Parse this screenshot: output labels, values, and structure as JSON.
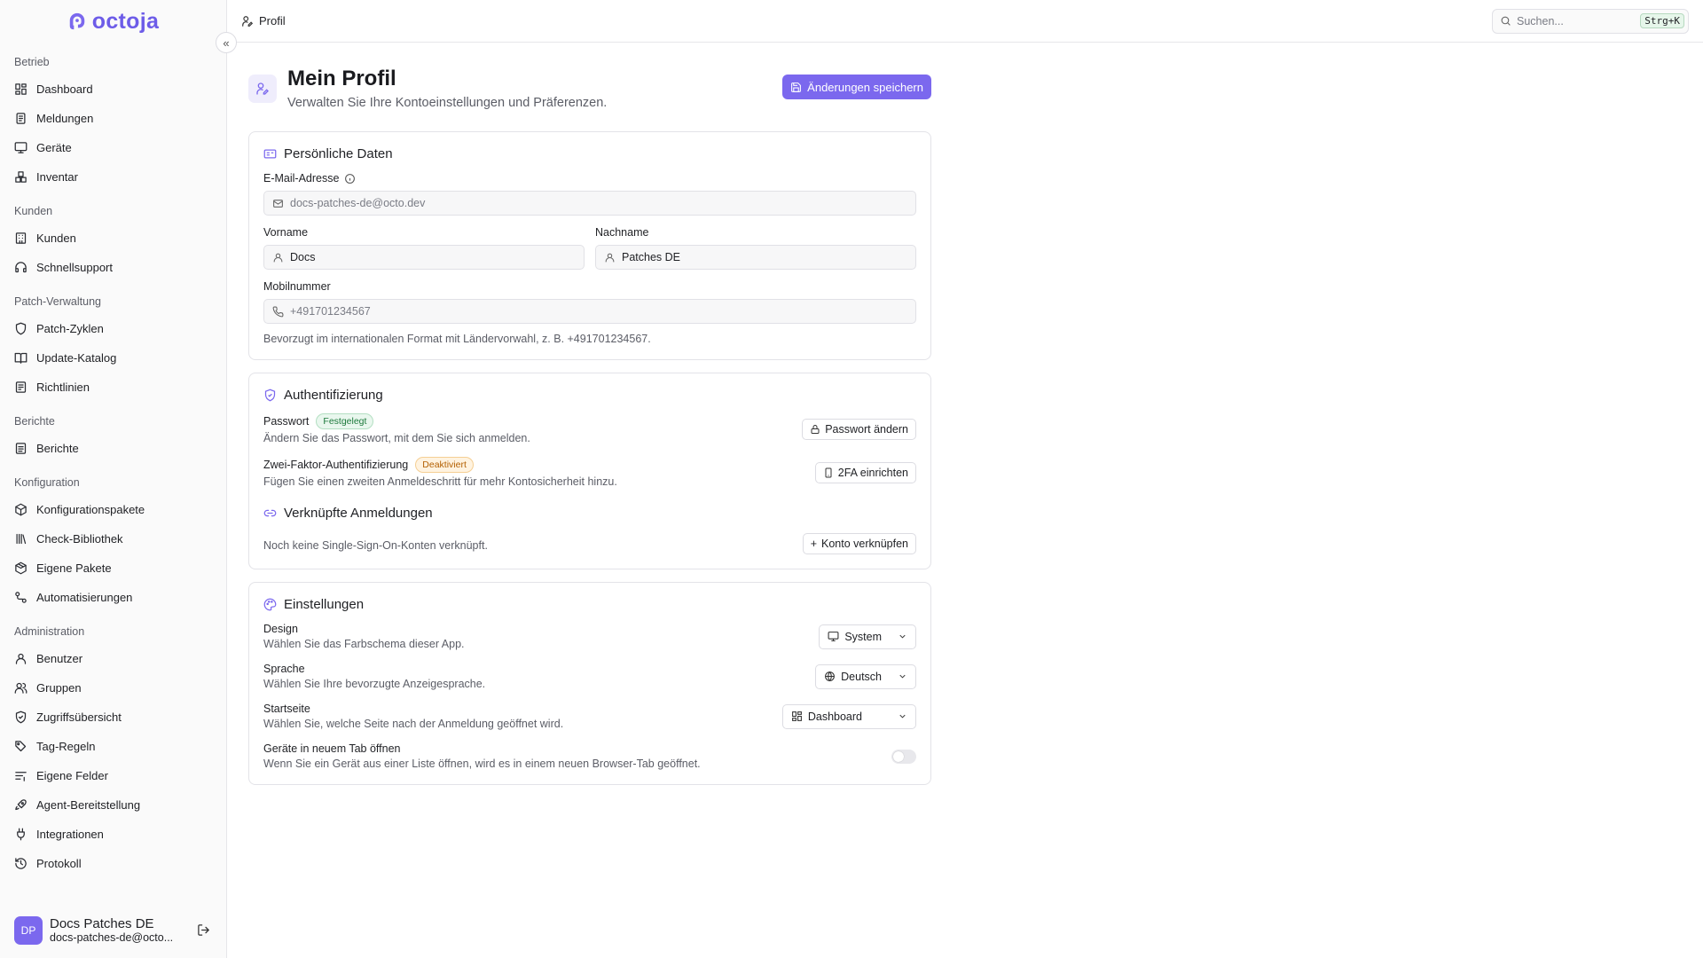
{
  "brand": {
    "name": "octoja",
    "accent": "#7b68ee"
  },
  "sidebar": {
    "groups": [
      {
        "title": "Betrieb",
        "items": [
          {
            "label": "Dashboard",
            "icon": "dashboard-icon"
          },
          {
            "label": "Meldungen",
            "icon": "alerts-icon"
          },
          {
            "label": "Geräte",
            "icon": "monitor-icon"
          },
          {
            "label": "Inventar",
            "icon": "boxes-icon"
          }
        ]
      },
      {
        "title": "Kunden",
        "items": [
          {
            "label": "Kunden",
            "icon": "building-icon"
          },
          {
            "label": "Schnellsupport",
            "icon": "headset-icon"
          }
        ]
      },
      {
        "title": "Patch-Verwaltung",
        "items": [
          {
            "label": "Patch-Zyklen",
            "icon": "shield-icon"
          },
          {
            "label": "Update-Katalog",
            "icon": "book-icon"
          },
          {
            "label": "Richtlinien",
            "icon": "policy-icon"
          }
        ]
      },
      {
        "title": "Berichte",
        "items": [
          {
            "label": "Berichte",
            "icon": "report-icon"
          }
        ]
      },
      {
        "title": "Konfiguration",
        "items": [
          {
            "label": "Konfigurationspakete",
            "icon": "package-icon"
          },
          {
            "label": "Check-Bibliothek",
            "icon": "library-icon"
          },
          {
            "label": "Eigene Pakete",
            "icon": "packages-icon"
          },
          {
            "label": "Automatisierungen",
            "icon": "workflow-icon"
          }
        ]
      },
      {
        "title": "Administration",
        "items": [
          {
            "label": "Benutzer",
            "icon": "user-icon"
          },
          {
            "label": "Gruppen",
            "icon": "users-icon"
          },
          {
            "label": "Zugriffsübersicht",
            "icon": "shield-check-icon"
          },
          {
            "label": "Tag-Regeln",
            "icon": "tag-icon"
          },
          {
            "label": "Eigene Felder",
            "icon": "fields-icon"
          },
          {
            "label": "Agent-Bereitstellung",
            "icon": "rocket-icon"
          },
          {
            "label": "Integrationen",
            "icon": "plug-icon"
          },
          {
            "label": "Protokoll",
            "icon": "history-icon"
          }
        ]
      }
    ],
    "user": {
      "initials": "DP",
      "name": "Docs Patches DE",
      "email": "docs-patches-de@octo..."
    }
  },
  "topbar": {
    "breadcrumb": "Profil",
    "search_placeholder": "Suchen...",
    "search_shortcut": "Strg+K"
  },
  "page": {
    "title": "Mein Profil",
    "subtitle": "Verwalten Sie Ihre Kontoeinstellungen und Präferenzen.",
    "save_label": "Änderungen speichern"
  },
  "personal": {
    "title": "Persönliche Daten",
    "email_label": "E-Mail-Adresse",
    "email_value": "docs-patches-de@octo.dev",
    "firstname_label": "Vorname",
    "firstname_value": "Docs",
    "lastname_label": "Nachname",
    "lastname_value": "Patches DE",
    "mobile_label": "Mobilnummer",
    "mobile_placeholder": "+491701234567",
    "mobile_hint": "Bevorzugt im internationalen Format mit Ländervorwahl, z. B. +491701234567."
  },
  "auth": {
    "title": "Authentifizierung",
    "password_label": "Passwort",
    "password_badge": "Festgelegt",
    "password_desc": "Ändern Sie das Passwort, mit dem Sie sich anmelden.",
    "password_button": "Passwort ändern",
    "twofa_label": "Zwei-Faktor-Authentifizierung",
    "twofa_badge": "Deaktiviert",
    "twofa_desc": "Fügen Sie einen zweiten Anmeldeschritt für mehr Kontosicherheit hinzu.",
    "twofa_button": "2FA einrichten",
    "linked_title": "Verknüpfte Anmeldungen",
    "linked_desc": "Noch keine Single-Sign-On-Konten verknüpft.",
    "linked_button": "Konto verknüpfen"
  },
  "settings": {
    "title": "Einstellungen",
    "design_label": "Design",
    "design_desc": "Wählen Sie das Farbschema dieser App.",
    "design_value": "System",
    "language_label": "Sprache",
    "language_desc": "Wählen Sie Ihre bevorzugte Anzeigesprache.",
    "language_value": "Deutsch",
    "start_label": "Startseite",
    "start_desc": "Wählen Sie, welche Seite nach der Anmeldung geöffnet wird.",
    "start_value": "Dashboard",
    "newtab_label": "Geräte in neuem Tab öffnen",
    "newtab_desc": "Wenn Sie ein Gerät aus einer Liste öffnen, wird es in einem neuen Browser-Tab geöffnet.",
    "newtab_enabled": false
  }
}
